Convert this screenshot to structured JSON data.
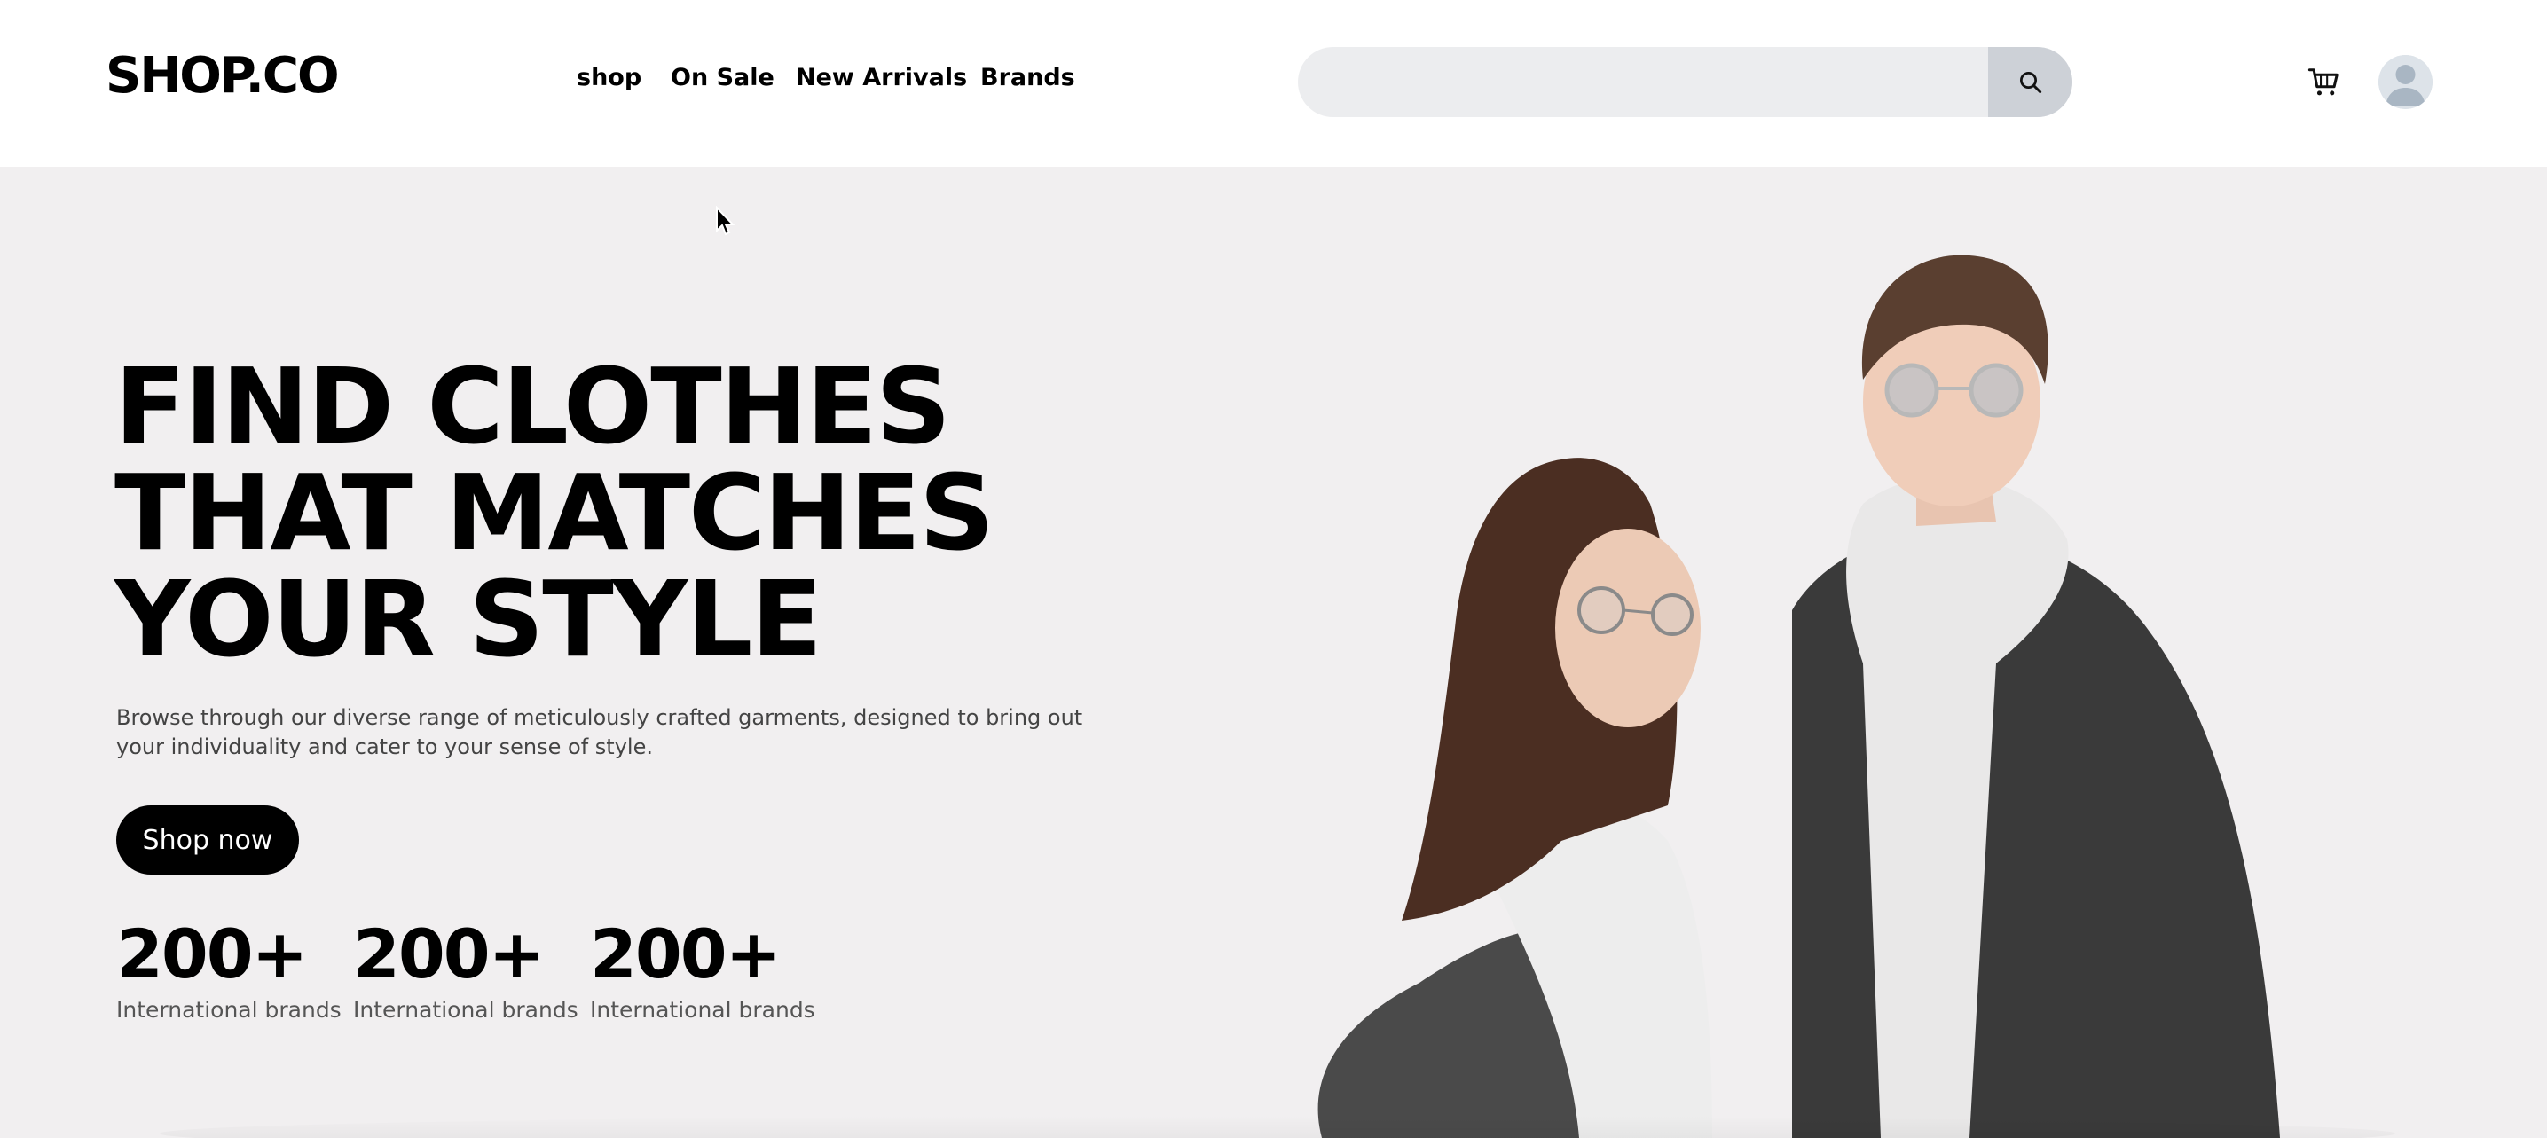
{
  "header": {
    "logo": "SHOP.CO",
    "nav": [
      {
        "label": "shop"
      },
      {
        "label": "On Sale"
      },
      {
        "label": "New Arrivals"
      },
      {
        "label": "Brands"
      }
    ],
    "search": {
      "placeholder": "",
      "value": "",
      "button_icon": "search-icon"
    },
    "cart_icon": "cart-icon",
    "avatar_icon": "user-avatar-icon"
  },
  "hero": {
    "title_lines": [
      "FIND CLOTHES",
      "THAT MATCHES",
      "YOUR STYLE"
    ],
    "description": "Browse through our diverse range of meticulously crafted garments, designed to bring out your individuality and cater to your sense of style.",
    "cta_label": "Shop now",
    "stats": [
      {
        "value": "200+",
        "label": "International brands"
      },
      {
        "value": "200+",
        "label": "International brands"
      },
      {
        "value": "200+",
        "label": "International brands"
      }
    ],
    "image": "couple-in-denim-jackets-photo"
  },
  "colors": {
    "hero_background": "#f1eff0",
    "search_background": "#ecedef",
    "search_button": "#cdd1d7",
    "button_background": "#000000",
    "button_text": "#ffffff"
  }
}
